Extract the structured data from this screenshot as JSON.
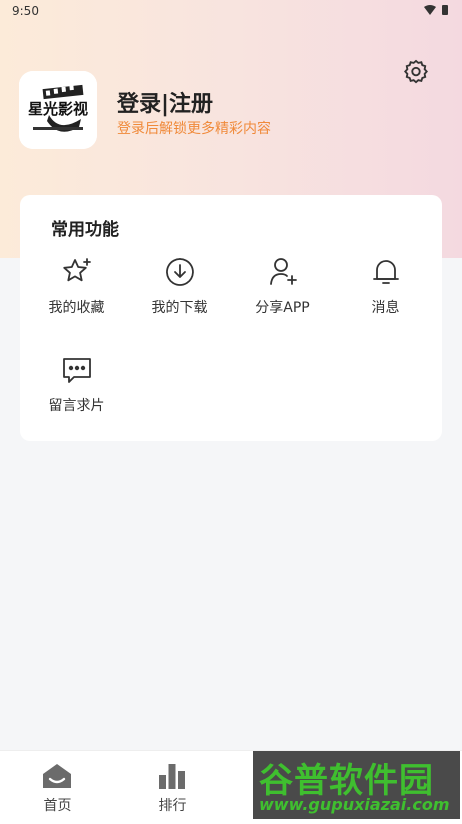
{
  "status_bar": {
    "time": "9:50"
  },
  "header": {
    "logo_text": "星光影视",
    "login_title": "登录|注册",
    "login_subtitle": "登录后解锁更多精彩内容"
  },
  "functions_card": {
    "title": "常用功能",
    "items": [
      {
        "label": "我的收藏",
        "icon": "star-icon"
      },
      {
        "label": "我的下载",
        "icon": "download-icon"
      },
      {
        "label": "分享APP",
        "icon": "add-user-icon"
      },
      {
        "label": "消息",
        "icon": "bell-icon"
      },
      {
        "label": "留言求片",
        "icon": "chat-icon"
      }
    ]
  },
  "tab_bar": {
    "tabs": [
      {
        "label": "首页",
        "icon": "home-icon"
      },
      {
        "label": "排行",
        "icon": "chart-icon"
      }
    ]
  },
  "watermark": {
    "cn": "谷普软件园",
    "en": "www.gupuxiazai.com"
  },
  "colors": {
    "accent": "#f08a3a",
    "watermark_green": "#3fbf2f"
  }
}
